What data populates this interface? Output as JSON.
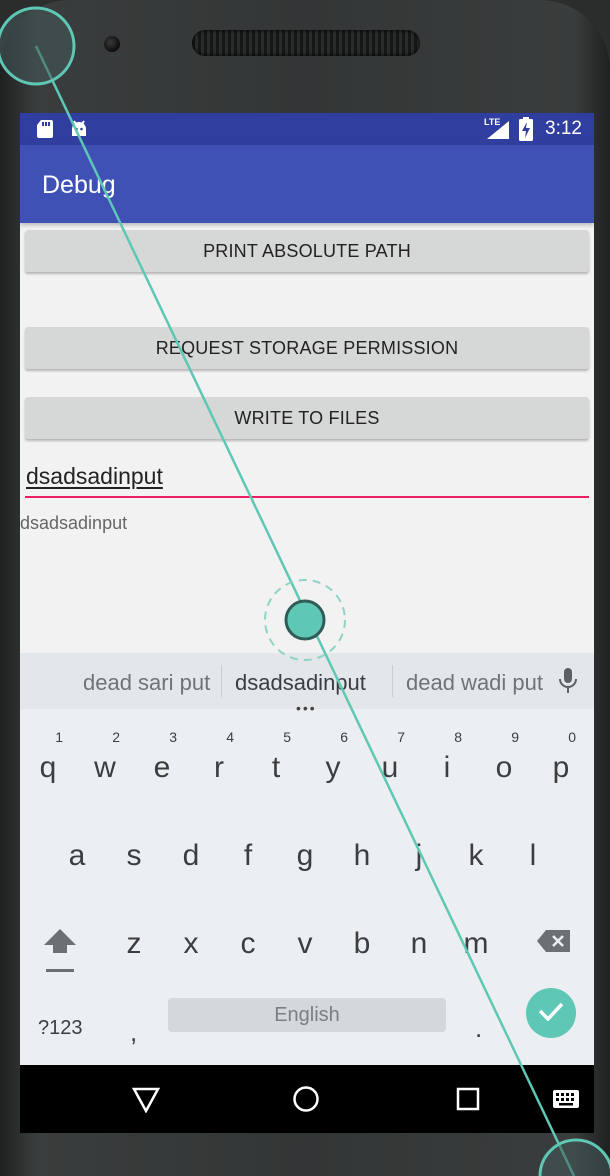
{
  "status_bar": {
    "time": "3:12",
    "network_label": "LTE",
    "left_icons": [
      "sd-card-icon",
      "android-debug-icon"
    ],
    "right_icons": [
      "signal-icon",
      "battery-charging-icon"
    ]
  },
  "app_bar": {
    "title": "Debug"
  },
  "buttons": {
    "print_path": "PRINT ABSOLUTE PATH",
    "request_permission": "REQUEST STORAGE PERMISSION",
    "write_files": "WRITE TO FILES"
  },
  "input": {
    "value": "dsadsadinput"
  },
  "echo_text": "dsadsadinput",
  "keyboard": {
    "suggestions": [
      "dead sari put",
      "dsadsadinput",
      "dead wadi put"
    ],
    "more_indicator": "•••",
    "row1": [
      {
        "key": "q",
        "hint": "1"
      },
      {
        "key": "w",
        "hint": "2"
      },
      {
        "key": "e",
        "hint": "3"
      },
      {
        "key": "r",
        "hint": "4"
      },
      {
        "key": "t",
        "hint": "5"
      },
      {
        "key": "y",
        "hint": "6"
      },
      {
        "key": "u",
        "hint": "7"
      },
      {
        "key": "i",
        "hint": "8"
      },
      {
        "key": "o",
        "hint": "9"
      },
      {
        "key": "p",
        "hint": "0"
      }
    ],
    "row2": [
      "a",
      "s",
      "d",
      "f",
      "g",
      "h",
      "j",
      "k",
      "l"
    ],
    "row3": [
      "z",
      "x",
      "c",
      "v",
      "b",
      "n",
      "m"
    ],
    "symbols_label": "?123",
    "comma_label": ",",
    "space_label": "English",
    "period_label": ".",
    "icons": [
      "mic-icon",
      "shift-icon",
      "backspace-icon",
      "enter-check-icon"
    ]
  },
  "nav_bar": {
    "icons": [
      "back-icon",
      "home-icon",
      "recents-icon",
      "keyboard-switch-icon"
    ]
  },
  "colors": {
    "status_bar": "#303f9f",
    "app_bar": "#3f51b5",
    "input_underline": "#e91e63",
    "touch_indicator": "#5ec7b5"
  }
}
